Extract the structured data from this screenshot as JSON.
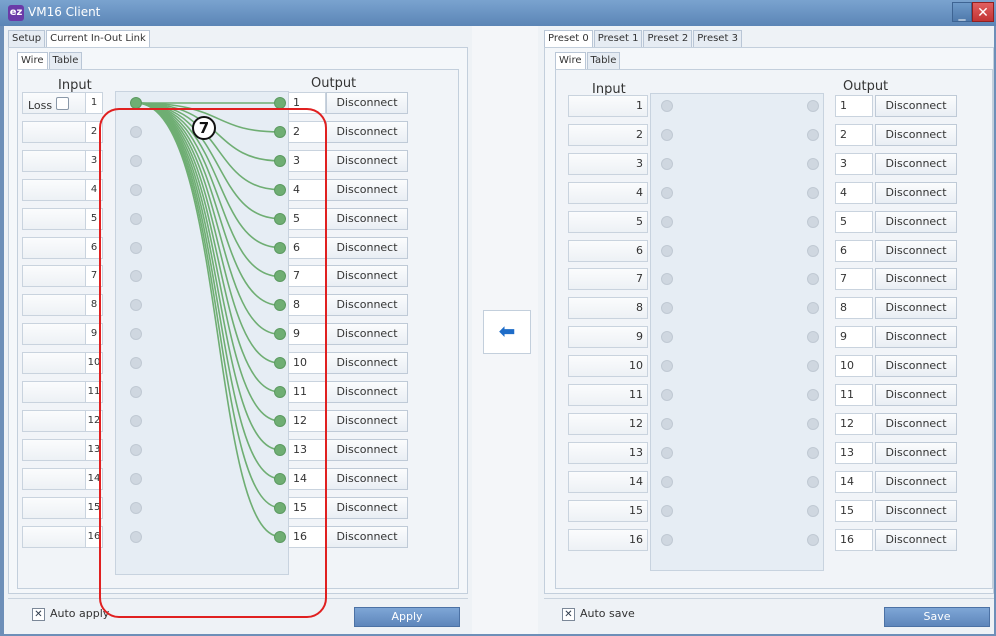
{
  "window": {
    "title": "VM16 Client",
    "icon": "app-logo-icon",
    "minimize_label": "_",
    "close_label": "✕"
  },
  "left_panel": {
    "tabs": [
      "Setup",
      "Current In-Out Link"
    ],
    "subtabs": [
      "Wire",
      "Table"
    ],
    "input_title": "Input",
    "output_title": "Output",
    "loss_label": "Loss",
    "callout": "7",
    "auto_apply_label": "Auto apply",
    "apply_label": "Apply",
    "inputs": [
      "1",
      "2",
      "3",
      "4",
      "5",
      "6",
      "7",
      "8",
      "9",
      "10",
      "11",
      "12",
      "13",
      "14",
      "15",
      "16"
    ],
    "outputs": [
      "1",
      "2",
      "3",
      "4",
      "5",
      "6",
      "7",
      "8",
      "9",
      "10",
      "11",
      "12",
      "13",
      "14",
      "15",
      "16"
    ],
    "disconnect_label": "Disconnect",
    "links": [
      [
        1,
        1
      ],
      [
        1,
        2
      ],
      [
        1,
        3
      ],
      [
        1,
        4
      ],
      [
        1,
        5
      ],
      [
        1,
        6
      ],
      [
        1,
        7
      ],
      [
        1,
        8
      ],
      [
        1,
        9
      ],
      [
        1,
        10
      ],
      [
        1,
        11
      ],
      [
        1,
        12
      ],
      [
        1,
        13
      ],
      [
        1,
        14
      ],
      [
        1,
        15
      ],
      [
        1,
        16
      ]
    ]
  },
  "right_panel": {
    "tabs": [
      "Preset 0",
      "Preset 1",
      "Preset 2",
      "Preset 3"
    ],
    "subtabs": [
      "Wire",
      "Table"
    ],
    "input_title": "Input",
    "output_title": "Output",
    "auto_save_label": "Auto save",
    "save_label": "Save",
    "inputs": [
      "1",
      "2",
      "3",
      "4",
      "5",
      "6",
      "7",
      "8",
      "9",
      "10",
      "11",
      "12",
      "13",
      "14",
      "15",
      "16"
    ],
    "outputs": [
      "1",
      "2",
      "3",
      "4",
      "5",
      "6",
      "7",
      "8",
      "9",
      "10",
      "11",
      "12",
      "13",
      "14",
      "15",
      "16"
    ],
    "disconnect_label": "Disconnect"
  },
  "transfer_icon": "arrow-left-icon",
  "colors": {
    "wire": "#6fae73",
    "highlight": "#e02020",
    "accent": "#5e86bb"
  }
}
